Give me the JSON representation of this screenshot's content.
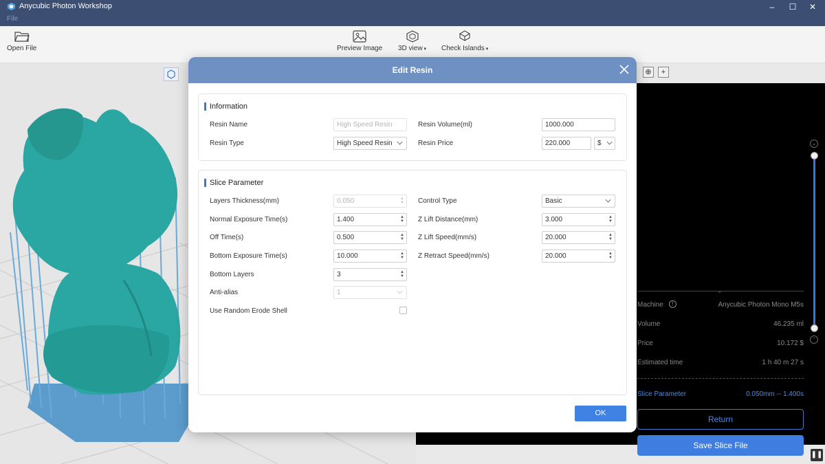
{
  "window": {
    "title": "Anycubic Photon Workshop",
    "menu_file": "File",
    "min_icon": "minimize-icon",
    "max_icon": "maximize-icon",
    "close_icon": "close-icon"
  },
  "toolbar": {
    "open_file": "Open File",
    "preview_image": "Preview Image",
    "view_3d": "3D view",
    "check_islands": "Check Islands"
  },
  "right_panel": {
    "machine_label": "Machine",
    "machine_value": "Anycubic Photon Mono M5s",
    "volume_label": "Volume",
    "volume_value": "46.235 ml",
    "price_label": "Price",
    "price_value": "10.172 $",
    "time_label": "Estimated time",
    "time_value": "1 h 40 m 27 s",
    "slice_param_label": "Slice Parameter",
    "slice_param_value": "0.050mm -- 1.400s",
    "return_label": "Return",
    "save_label": "Save Slice File"
  },
  "modal": {
    "title": "Edit Resin",
    "ok_label": "OK",
    "information": {
      "title": "Information",
      "resin_name_label": "Resin Name",
      "resin_name_placeholder": "High Speed Resin",
      "resin_type_label": "Resin Type",
      "resin_type_value": "High Speed Resin",
      "resin_volume_label": "Resin Volume(ml)",
      "resin_volume_value": "1000.000",
      "resin_price_label": "Resin Price",
      "resin_price_value": "220.000",
      "currency_value": "$"
    },
    "slice": {
      "title": "Slice Parameter",
      "layer_thickness_label": "Layers Thickness(mm)",
      "layer_thickness_value": "0.050",
      "normal_exposure_label": "Normal Exposure Time(s)",
      "normal_exposure_value": "1.400",
      "off_time_label": "Off Time(s)",
      "off_time_value": "0.500",
      "bottom_exposure_label": "Bottom Exposure Time(s)",
      "bottom_exposure_value": "10.000",
      "bottom_layers_label": "Bottom Layers",
      "bottom_layers_value": "3",
      "anti_alias_label": "Anti-alias",
      "anti_alias_value": "1",
      "random_erode_label": "Use Random Erode Shell",
      "control_type_label": "Control Type",
      "control_type_value": "Basic",
      "z_lift_distance_label": "Z Lift Distance(mm)",
      "z_lift_distance_value": "3.000",
      "z_lift_speed_label": "Z Lift Speed(mm/s)",
      "z_lift_speed_value": "20.000",
      "z_retract_speed_label": "Z Retract Speed(mm/s)",
      "z_retract_speed_value": "20.000"
    }
  },
  "colors": {
    "titlebar": "#3c4e71",
    "modal_header": "#6e90c3",
    "accent": "#3f7de0",
    "model": "#2aa7a2",
    "supports": "#5b9ccd"
  }
}
